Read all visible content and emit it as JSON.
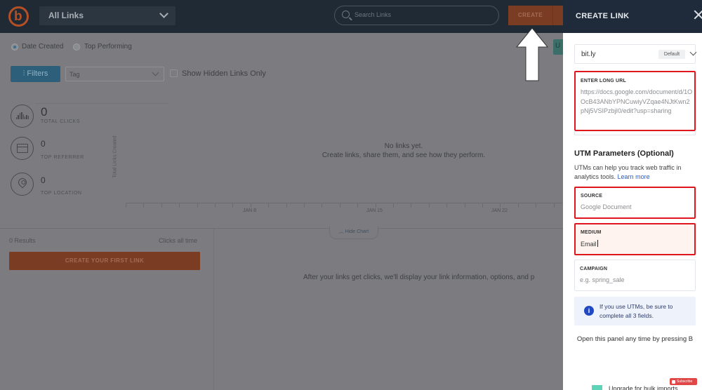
{
  "app": {
    "logo_letter": "b",
    "links_dropdown": "All Links",
    "search_placeholder": "Search Links",
    "create_button": "CREATE",
    "upgrade_peek": "U"
  },
  "sort": {
    "options": [
      {
        "label": "Date Created",
        "selected": true
      },
      {
        "label": "Top Performing",
        "selected": false
      }
    ]
  },
  "filters": {
    "filters_button": "Filters",
    "tag_select": "Tag",
    "show_hidden_label": "Show Hidden Links Only",
    "show_hidden_checked": false
  },
  "stats": [
    {
      "icon": "bar-chart-icon",
      "value": "0",
      "label": "TOTAL CLICKS"
    },
    {
      "icon": "browser-window-icon",
      "value": "0",
      "label": "TOP REFERRER"
    },
    {
      "icon": "location-pin-icon",
      "value": "0",
      "label": "TOP LOCATION"
    }
  ],
  "chart_data": {
    "type": "bar",
    "title": "",
    "ylabel": "Total Links Created",
    "xlabel": "",
    "categories": [
      "JAN 8",
      "JAN 15",
      "JAN 22"
    ],
    "values": [],
    "empty_title": "No links yet.",
    "empty_subtitle": "Create links, share them, and see how they perform.",
    "grid": false
  },
  "chart_toggle": "Hide Chart",
  "list": {
    "results": "0 Results",
    "sort_label": "Clicks all time",
    "create_first_button": "CREATE YOUR FIRST LINK",
    "empty_detail": "After your links get clicks, we'll display your link information, options, and p"
  },
  "panel": {
    "title": "CREATE LINK",
    "domain": "bit.ly",
    "domain_badge": "Default",
    "long_url_label": "ENTER LONG URL",
    "long_url_value": "https://docs.google.com/document/d/1OOcB43ANbYPNCuwiyVZqae4NJtKwn2pNj5VSIPzbjI0/edit?usp=sharing",
    "utm_title": "UTM Parameters (Optional)",
    "utm_desc": "UTMs can help you track web traffic in analytics tools.",
    "utm_learn_more": "Learn more",
    "source_label": "SOURCE",
    "source_value": "Google Document",
    "medium_label": "MEDIUM",
    "medium_value": "Email",
    "campaign_label": "CAMPAIGN",
    "campaign_placeholder": "e.g. spring_sale",
    "info_text": "If you use UTMs, be sure to complete all 3 fields.",
    "hint": "Open this panel any time by pressing B",
    "upgrade_text": "Upgrade for bulk imports",
    "subscribe_badge": "Subscribe"
  },
  "colors": {
    "brand_orange": "#ee6123",
    "nav_dark": "#1f2a35",
    "highlight_red": "#e0161d",
    "link_blue": "#2f5bb7",
    "info_blue": "#1f49c2"
  }
}
